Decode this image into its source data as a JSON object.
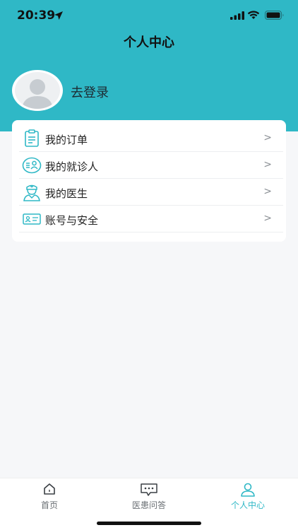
{
  "status_bar": {
    "time": "20:39"
  },
  "header": {
    "title": "个人中心"
  },
  "profile": {
    "login_label": "去登录"
  },
  "menu": {
    "items": [
      {
        "label": "我的订单",
        "icon": "clipboard-icon",
        "chevron": ">"
      },
      {
        "label": "我的就诊人",
        "icon": "patient-list-icon",
        "chevron": ">"
      },
      {
        "label": "我的医生",
        "icon": "doctor-icon",
        "chevron": ">"
      },
      {
        "label": "账号与安全",
        "icon": "id-card-icon",
        "chevron": ">"
      }
    ]
  },
  "tabbar": {
    "tabs": [
      {
        "label": "首页",
        "icon": "home-icon"
      },
      {
        "label": "医患问答",
        "icon": "chat-bubble-icon"
      },
      {
        "label": "个人中心",
        "icon": "user-icon"
      }
    ],
    "active_index": 2
  },
  "colors": {
    "accent": "#2fb8c6",
    "background": "#f6f7f9"
  }
}
